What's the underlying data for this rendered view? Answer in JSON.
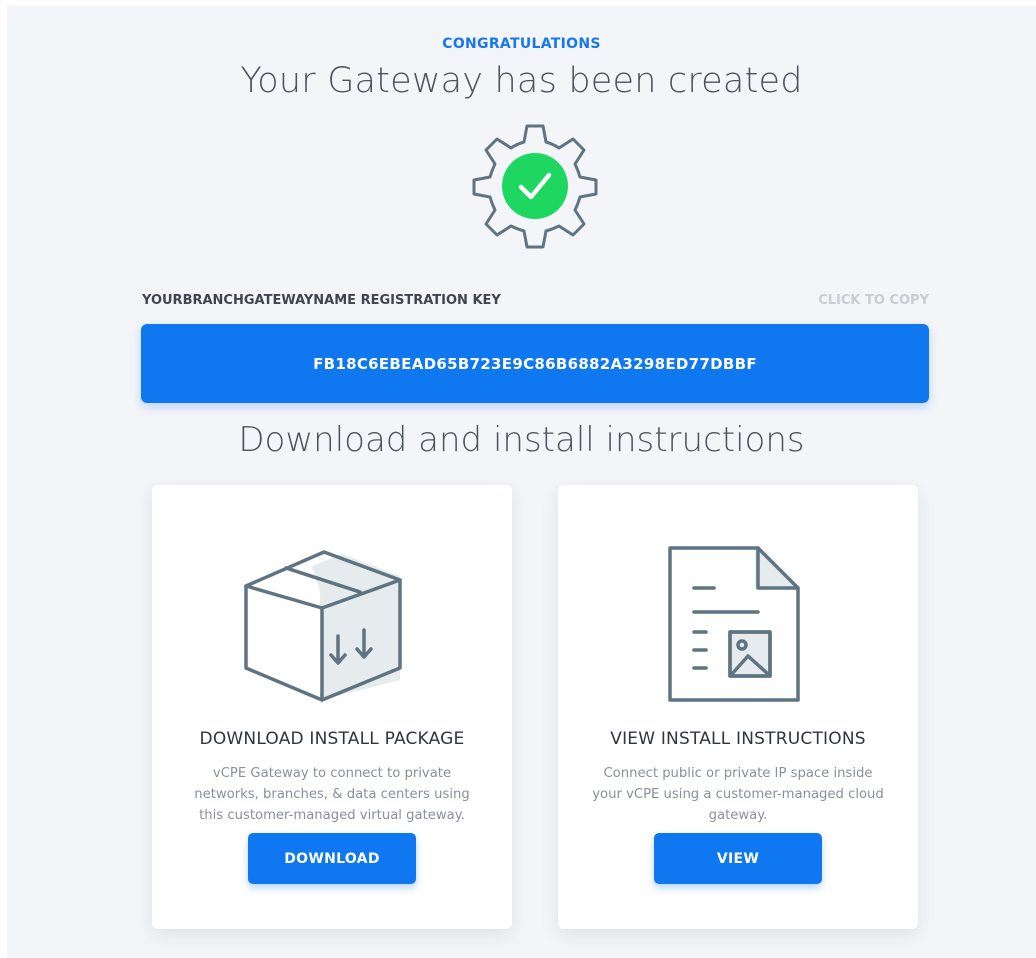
{
  "header": {
    "eyebrow": "CONGRATULATIONS",
    "title": "Your Gateway has been created"
  },
  "status_icon": "gear-check-icon",
  "registration": {
    "label": "YOURBRANCHGATEWAYNAME REGISTRATION KEY",
    "copy_label": "CLICK TO COPY",
    "key": "FB18C6EBEAD65B723E9C86B6882A3298ED77DBBF"
  },
  "instructions": {
    "heading": "Download and install instructions",
    "cards": [
      {
        "icon": "package-download-icon",
        "title": "DOWNLOAD INSTALL PACKAGE",
        "description": "vCPE Gateway to connect to private networks, branches, & data centers using this customer-managed virtual gateway.",
        "button": "DOWNLOAD"
      },
      {
        "icon": "document-image-icon",
        "title": "VIEW INSTALL INSTRUCTIONS",
        "description": "Connect public or private IP space inside your vCPE using a customer-managed cloud gateway.",
        "button": "VIEW"
      }
    ]
  },
  "colors": {
    "accent": "#0f77f0",
    "success": "#1ed760",
    "icon_stroke": "#5f7482"
  }
}
